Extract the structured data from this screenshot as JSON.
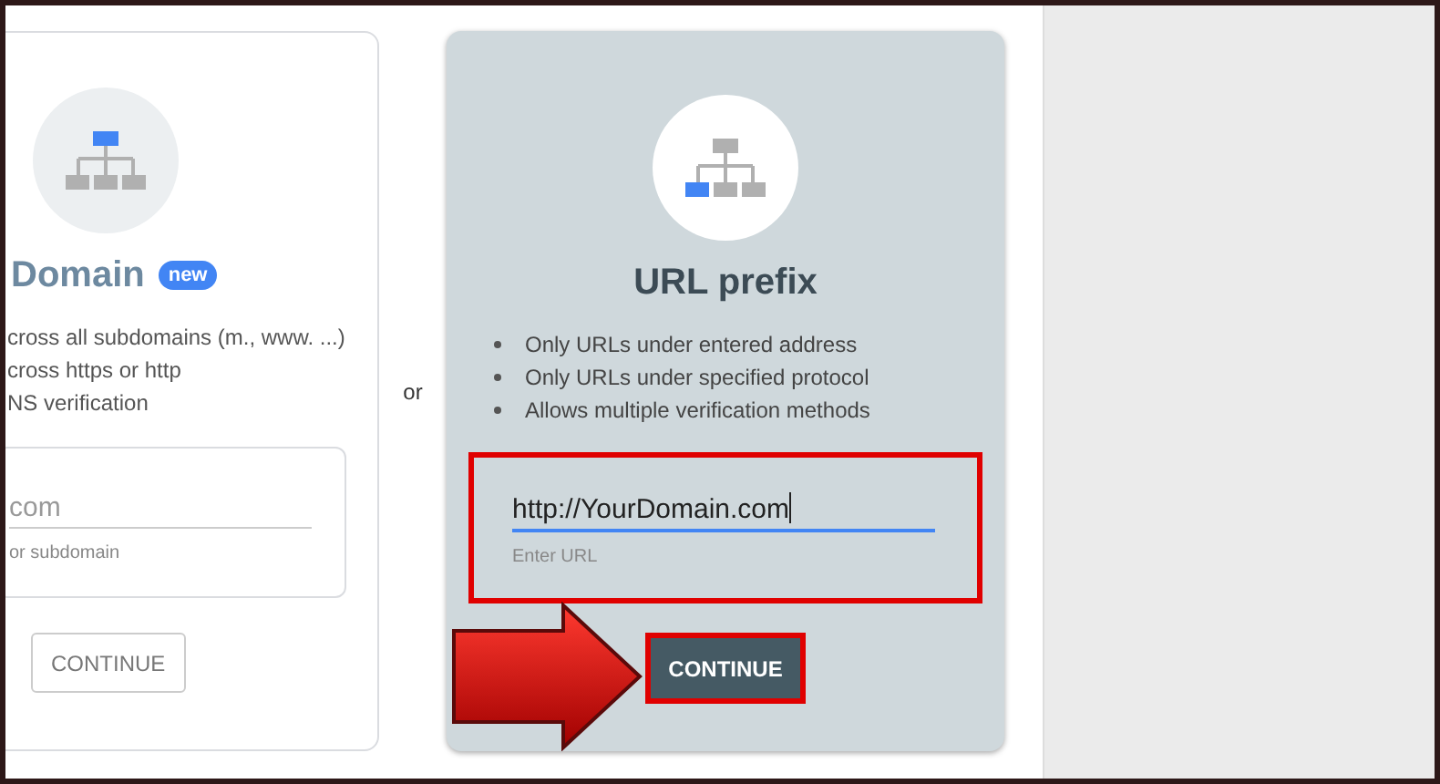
{
  "cards": [
    {
      "kind": "domain",
      "selected": false,
      "title": "Domain",
      "badge": "new",
      "features": [
        "cross all subdomains (m., www. ...)",
        "cross https or http",
        "NS verification"
      ],
      "field": {
        "placeholder": "com",
        "helper": "or subdomain",
        "focused": false,
        "highlighted": false
      },
      "button": {
        "label": "CONTINUE",
        "highlighted": false
      }
    },
    {
      "kind": "url",
      "selected": true,
      "title": "URL prefix",
      "features": [
        "Only URLs under entered address",
        "Only URLs under specified protocol",
        "Allows multiple verification methods"
      ],
      "field": {
        "value": "http://YourDomain.com",
        "helper": "Enter URL",
        "focused": true,
        "highlighted": true
      },
      "button": {
        "label": "CONTINUE",
        "highlighted": true
      }
    }
  ],
  "separator": "or",
  "annotation_arrow": true
}
